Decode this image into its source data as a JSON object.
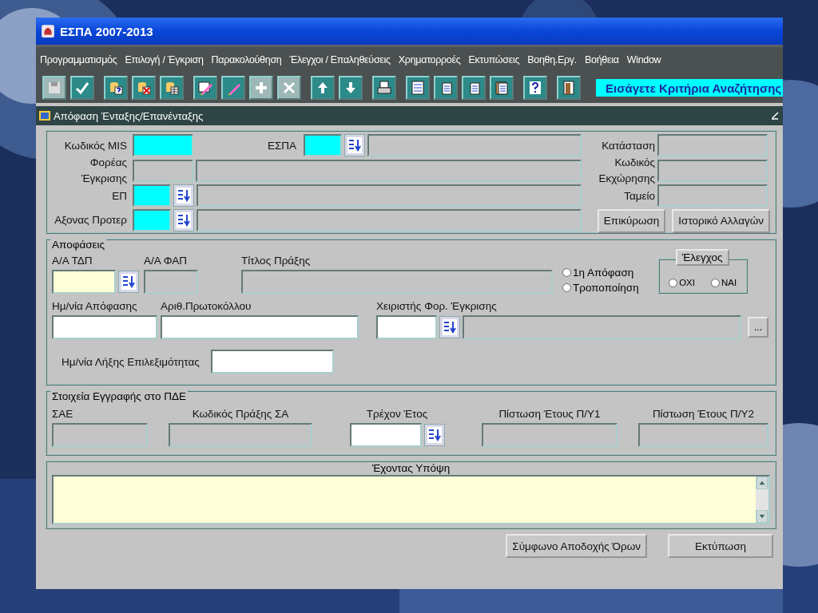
{
  "window": {
    "title": "ΕΣΠΑ 2007-2013"
  },
  "menu": [
    "Προγραμματισμός",
    "Επιλογή / Έγκριση",
    "Παρακολούθηση",
    "Έλεγχοι / Επαληθεύσεις",
    "Χρηματορροές",
    "Εκτυπώσεις",
    "Βοηθη.Εργ.",
    "Βοήθεια",
    "Window"
  ],
  "toolbar": [
    {
      "kind": "save",
      "disabled": true,
      "gap_before": false
    },
    {
      "kind": "accept",
      "disabled": false,
      "gap_before": false
    },
    {
      "kind": "query",
      "disabled": false,
      "gap_before": true
    },
    {
      "kind": "cancel-query",
      "disabled": false,
      "gap_before": false
    },
    {
      "kind": "count",
      "disabled": false,
      "gap_before": false
    },
    {
      "kind": "window-edit",
      "disabled": false,
      "gap_before": true
    },
    {
      "kind": "edit",
      "disabled": false,
      "gap_before": false
    },
    {
      "kind": "insert",
      "disabled": true,
      "gap_before": false
    },
    {
      "kind": "delete",
      "disabled": true,
      "gap_before": false
    },
    {
      "kind": "up",
      "disabled": false,
      "gap_before": true
    },
    {
      "kind": "down",
      "disabled": false,
      "gap_before": false
    },
    {
      "kind": "print",
      "disabled": false,
      "gap_before": true
    },
    {
      "kind": "list",
      "disabled": false,
      "gap_before": true
    },
    {
      "kind": "doc-edit",
      "disabled": false,
      "gap_before": false
    },
    {
      "kind": "copy",
      "disabled": false,
      "gap_before": false
    },
    {
      "kind": "paste",
      "disabled": false,
      "gap_before": false
    },
    {
      "kind": "help",
      "disabled": false,
      "gap_before": true
    },
    {
      "kind": "exit",
      "disabled": false,
      "gap_before": true
    }
  ],
  "hint": "Εισάγετε Κριτήρια Αναζήτησης",
  "form": {
    "title": "Απόφαση Ένταξης/Επανένταξης"
  },
  "header": {
    "mis": {
      "label": "Κωδικός MIS",
      "required": true
    },
    "espa": {
      "label": "ΕΣΠΑ",
      "required": true,
      "lov": true
    },
    "body": {
      "label": "Φορέας Έγκρισης",
      "readonly": true
    },
    "op": {
      "label": "ΕΠ",
      "required": true,
      "lov": true
    },
    "axis": {
      "label": "Αξονας Προτερ",
      "required": true,
      "lov": true
    },
    "status": {
      "label": "Κατάσταση",
      "readonly": true
    },
    "code": {
      "label": "Κωδικός Εκχώρησης",
      "readonly": true
    },
    "fund": {
      "label": "Ταμείο",
      "readonly": true
    },
    "buttons": [
      "Επικύρωση",
      "Ιστορικό Αλλαγών"
    ]
  },
  "decisions": {
    "title": "Αποφάσεις",
    "tdp": {
      "label": "Α/Α ΤΔΠ",
      "current": true,
      "lov": true
    },
    "fap": {
      "label": "Α/Α ΦΑΠ",
      "readonly": true
    },
    "deed": {
      "label": "Τίτλος  Πράξης",
      "readonly": true
    },
    "decision_type": [
      {
        "label": "1η Απόφαση",
        "selected": false
      },
      {
        "label": "Τροποποίηση",
        "selected": false
      }
    ],
    "check": {
      "label": "Έλεγχος",
      "options": [
        {
          "label": "ΟΧΙ",
          "selected": false
        },
        {
          "label": "ΝΑΙ",
          "selected": false
        }
      ]
    },
    "date": {
      "label": "Ημ/νία Απόφασης",
      "readonly": false
    },
    "protocol": {
      "label": "Αριθ.Πρωτοκόλλου",
      "readonly": false
    },
    "operator": {
      "label": "Χειριστής Φορ. Έγκρισης",
      "readonly": false,
      "lov": true,
      "more": "..."
    },
    "expiry": {
      "label": "Ημ/νία Λήξης Επιλεξιμότητας",
      "readonly": false
    }
  },
  "pde": {
    "title": "Στοιχεία Εγγραφής στο ΠΔΕ",
    "fields": [
      {
        "label": "ΣΑΕ",
        "readonly": true,
        "lov": false
      },
      {
        "label": "Κωδικός Πράξης ΣΑ",
        "readonly": true,
        "lov": false
      },
      {
        "label": "Τρέχον Έτος",
        "readonly": false,
        "lov": true
      },
      {
        "label": "Πίστωση Έτους Π/Υ1",
        "readonly": true,
        "lov": false
      },
      {
        "label": "Πίστωση Έτους Π/Υ2",
        "readonly": true,
        "lov": false
      }
    ]
  },
  "notes": {
    "title": "Έχοντας Υπόψη"
  },
  "footer_buttons": [
    "Σύμφωνο Αποδοχής Όρων",
    "Εκτύπωση"
  ]
}
